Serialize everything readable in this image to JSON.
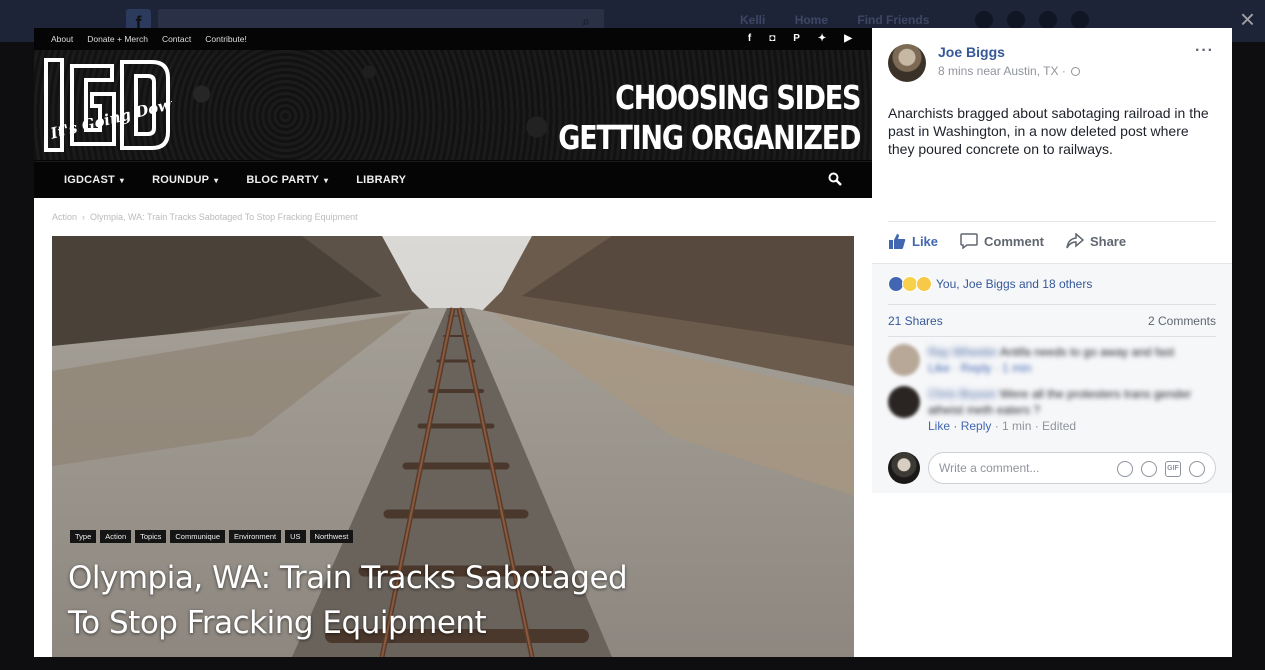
{
  "background": {
    "nav": [
      "Kelli",
      "Home",
      "Find Friends"
    ]
  },
  "viewer": {
    "close_glyph": "×"
  },
  "site": {
    "top_links": [
      "About",
      "Donate + Merch",
      "Contact",
      "Contribute!"
    ],
    "social_icons": [
      "facebook-icon",
      "instagram-icon",
      "patreon-icon",
      "twitter-icon",
      "youtube-icon"
    ],
    "logo_text": "IGD",
    "logo_script": "It's Going Down!",
    "banner_line1": "CHOOSING SIDES",
    "banner_line2": "GETTING ORGANIZED",
    "nav": [
      {
        "label": "IGDCAST",
        "chevron": "▾"
      },
      {
        "label": "ROUNDUP",
        "chevron": "▾"
      },
      {
        "label": "BLOC PARTY",
        "chevron": "▾"
      },
      {
        "label": "LIBRARY",
        "chevron": ""
      }
    ],
    "breadcrumb": [
      "Action",
      "Olympia, WA: Train Tracks Sabotaged To Stop Fracking Equipment"
    ],
    "breadcrumb_sep": "›",
    "tags": [
      "Type",
      "Action",
      "Topics",
      "Communique",
      "Environment",
      "US",
      "Northwest"
    ],
    "article_title_line1": "Olympia, WA: Train Tracks Sabotaged",
    "article_title_line2": "To Stop Fracking Equipment"
  },
  "post": {
    "author": "Joe Biggs",
    "meta": "8 mins near Austin, TX ·",
    "more": "···",
    "text": "Anarchists bragged about sabotaging railroad in the past in Washington, in a now deleted post where they poured concrete on to railways.",
    "actions": {
      "like": "Like",
      "comment": "Comment",
      "share": "Share"
    },
    "reactions_text": "You, Joe Biggs and 18 others",
    "shares": "21 Shares",
    "comments_count": "2 Comments",
    "comments": [
      {
        "name": "Ray Wheeler",
        "text": "Antifa needs to go away and fast",
        "meta": "Like · Reply · 1 min"
      },
      {
        "name": "Chris Bryson",
        "text": "Were all the protesters trans gender atheist meth eaters ?",
        "meta_like": "Like",
        "meta_reply": "Reply",
        "meta_rest": "· 1 min · Edited"
      }
    ],
    "write_placeholder": "Write a comment...",
    "colors": {
      "link": "#365899",
      "accent": "#4267b2"
    }
  }
}
